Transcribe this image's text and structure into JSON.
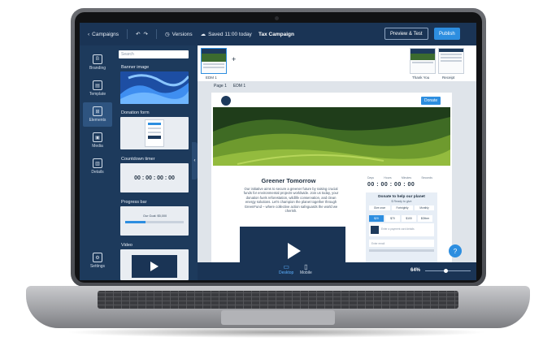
{
  "topbar": {
    "back_label": "Campaigns",
    "versions_label": "Versions",
    "saved_label": "Saved 11:00 today",
    "title": "Tax Campaign",
    "preview_label": "Preview & Test",
    "publish_label": "Publish"
  },
  "rail": {
    "items": [
      {
        "label": "Branding",
        "icon": "branding-icon"
      },
      {
        "label": "Template",
        "icon": "template-icon"
      },
      {
        "label": "Elements",
        "icon": "elements-icon"
      },
      {
        "label": "Media",
        "icon": "media-icon"
      },
      {
        "label": "Details",
        "icon": "details-icon"
      },
      {
        "label": "Settings",
        "icon": "settings-icon"
      }
    ],
    "active": "Elements"
  },
  "panel": {
    "search_placeholder": "Search",
    "components": [
      {
        "label": "Banner image"
      },
      {
        "label": "Donation form"
      },
      {
        "label": "Countdown timer",
        "timer": "00 : 00 : 00 : 00"
      },
      {
        "label": "Progress bar",
        "caption": "Our Goal: $5,000",
        "progress": 0.35
      },
      {
        "label": "Video"
      }
    ]
  },
  "emails": {
    "items": [
      {
        "label": "EDM 1",
        "active": true
      },
      {
        "label": "Thank You"
      },
      {
        "label": "Receipt"
      }
    ]
  },
  "canvas": {
    "page_tabs": [
      "Page 1",
      "EDM 1"
    ],
    "donate_label": "Donate",
    "headline": "Greener Tomorrow",
    "body": "Our initiative aims to secure a greener future by raising crucial funds for environmental projects worldwide. Join us today, your donation fuels reforestation, wildlife conservation, and clean energy solutions. Let's champion the planet together through GreenFund – where collective action safeguards the world we cherish.",
    "timer_labels": [
      "Days",
      "Hours",
      "Minutes",
      "Seconds"
    ],
    "timer_value": "00 : 00 : 00 : 00",
    "form": {
      "title": "Donate to help our planet",
      "subtitle": "$ Ready to give",
      "frequencies": [
        "Give once",
        "Fortnightly",
        "Monthly"
      ],
      "amounts": [
        "$20",
        "$70",
        "$100",
        "$Other"
      ],
      "card_placeholder": "Enter a payment card details",
      "email_placeholder": "Enter email"
    }
  },
  "bottombar": {
    "desktop_label": "Desktop",
    "mobile_label": "Mobile",
    "zoom": "64%",
    "zoom_fraction": 0.45
  },
  "help_label": "?"
}
